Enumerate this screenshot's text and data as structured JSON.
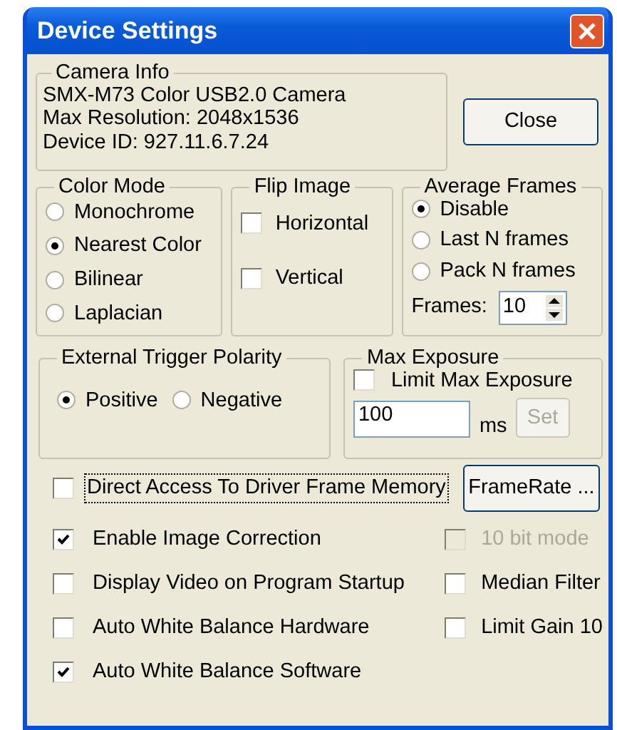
{
  "window": {
    "title": "Device Settings"
  },
  "camera_info": {
    "title": "Camera Info",
    "lines": [
      "SMX-M73 Color USB2.0 Camera",
      "Max Resolution: 2048x1536",
      "Device ID: 927.11.6.7.24"
    ]
  },
  "close_button": {
    "label": "Close"
  },
  "color_mode": {
    "title": "Color Mode",
    "options": [
      {
        "label": "Monochrome",
        "selected": false
      },
      {
        "label": "Nearest Color",
        "selected": true
      },
      {
        "label": "Bilinear",
        "selected": false
      },
      {
        "label": "Laplacian",
        "selected": false
      }
    ]
  },
  "flip_image": {
    "title": "Flip Image",
    "options": [
      {
        "label": "Horizontal",
        "checked": false
      },
      {
        "label": "Vertical",
        "checked": false
      }
    ]
  },
  "average_frames": {
    "title": "Average Frames",
    "options": [
      {
        "label": "Disable",
        "selected": true
      },
      {
        "label": "Last N frames",
        "selected": false
      },
      {
        "label": "Pack N frames",
        "selected": false
      }
    ],
    "frames_label": "Frames:",
    "frames_value": "10"
  },
  "trigger": {
    "title": "External Trigger Polarity",
    "options": [
      {
        "label": "Positive",
        "selected": true
      },
      {
        "label": "Negative",
        "selected": false
      }
    ]
  },
  "max_exposure": {
    "title": "Max Exposure",
    "limit": {
      "label": "Limit Max Exposure",
      "checked": false
    },
    "value": "100",
    "unit": "ms",
    "set_button": {
      "label": "Set",
      "disabled": true
    }
  },
  "direct_access": {
    "label": "Direct Access To Driver Frame Memory",
    "checked": false,
    "focused": true
  },
  "framerate_button": {
    "label": "FrameRate ..."
  },
  "left_options": [
    {
      "label": "Enable Image Correction",
      "checked": true,
      "disabled": false
    },
    {
      "label": "Display Video on Program Startup",
      "checked": false,
      "disabled": false
    },
    {
      "label": "Auto White Balance Hardware",
      "checked": false,
      "disabled": false
    },
    {
      "label": "Auto White Balance Software",
      "checked": true,
      "disabled": false
    }
  ],
  "right_options": [
    {
      "label": "10 bit mode",
      "checked": false,
      "disabled": true
    },
    {
      "label": "Median Filter",
      "checked": false,
      "disabled": false
    },
    {
      "label": "Limit Gain 10",
      "checked": false,
      "disabled": false
    }
  ]
}
